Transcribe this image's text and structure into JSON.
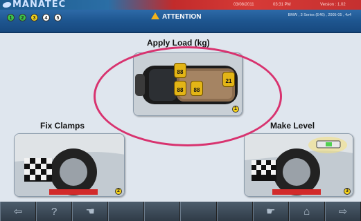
{
  "brand": {
    "name": "MANATEC"
  },
  "status": {
    "date": "03/08/2011",
    "time": "03:31 PM",
    "version": "Version : 1.02"
  },
  "header": {
    "steps": [
      "1",
      "2",
      "3",
      "4",
      "5"
    ],
    "title": "ATTENTION",
    "vehicle": "BMW , 3 Series (E46) , 2005-05 , 4x4"
  },
  "cards": {
    "apply_load": {
      "title": "Apply Load (kg)",
      "badge": "1",
      "weights": [
        "88",
        "88",
        "88",
        "21"
      ]
    },
    "fix_clamps": {
      "title": "Fix Clamps",
      "badge": "2"
    },
    "make_level": {
      "title": "Make Level",
      "badge": "3"
    }
  },
  "toolbar": {
    "icons": [
      "back-arrow-icon",
      "help-icon",
      "hand-icon",
      "",
      "",
      "",
      "",
      "hand-icon",
      "home-icon",
      "forward-arrow-icon"
    ]
  },
  "colors": {
    "accent": "#1e5690",
    "highlight": "#d8336f",
    "badge": "#f6d21a",
    "weight_tag": "#e3b516"
  }
}
